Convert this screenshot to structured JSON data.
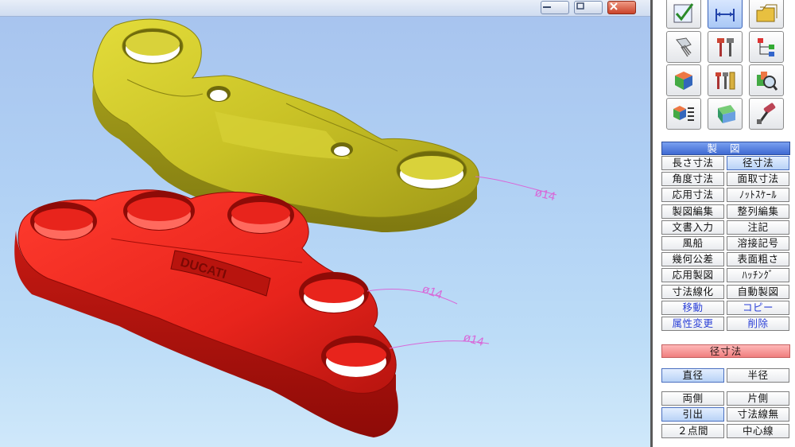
{
  "window": {
    "controls": [
      {
        "name": "minimize-button",
        "icon": "minimize-icon"
      },
      {
        "name": "restore-button",
        "icon": "restore-icon"
      },
      {
        "name": "close-button",
        "icon": "close-icon"
      }
    ]
  },
  "viewport": {
    "model_emblem": "DUCATI",
    "dimension_labels": [
      "ø14",
      "ø14",
      "ø14"
    ],
    "colors": {
      "yellow_part": "#c9c226",
      "red_part": "#e8241c",
      "dimension_line": "#d868d8"
    }
  },
  "toolbar": {
    "icons": [
      "check-edit-icon",
      "dimension-icon",
      "folders-icon",
      "bolt-icon",
      "tools-icon",
      "tree-icon",
      "cube-icon",
      "parts-tools-icon",
      "assembly-magnify-icon",
      "cube-list-icon",
      "solid-block-icon",
      "paint-roller-icon"
    ]
  },
  "section": {
    "title": "製 図"
  },
  "commands": [
    [
      "長さ寸法",
      "径寸法"
    ],
    [
      "角度寸法",
      "面取寸法"
    ],
    [
      "応用寸法",
      "ﾉｯﾄｽｹｰﾙ"
    ],
    [
      "製図編集",
      "整列編集"
    ],
    [
      "文書入力",
      "注記"
    ],
    [
      "風船",
      "溶接記号"
    ],
    [
      "幾何公差",
      "表面粗さ"
    ],
    [
      "応用製図",
      "ﾊｯﾁﾝｸﾞ"
    ],
    [
      "寸法線化",
      "自動製図"
    ],
    [
      "移動",
      "コピー"
    ],
    [
      "属性変更",
      "削除"
    ]
  ],
  "subpanel": {
    "title": "径寸法",
    "options": [
      [
        "直径",
        "半径"
      ],
      [
        "両側",
        "片側"
      ],
      [
        "引出",
        "寸法線無"
      ],
      [
        "２点間",
        "中心線"
      ]
    ]
  },
  "accent_colors": {
    "header_blue": "#3f6ad2",
    "header_red": "#f07e7e",
    "link_blue": "#2a3fd6"
  }
}
